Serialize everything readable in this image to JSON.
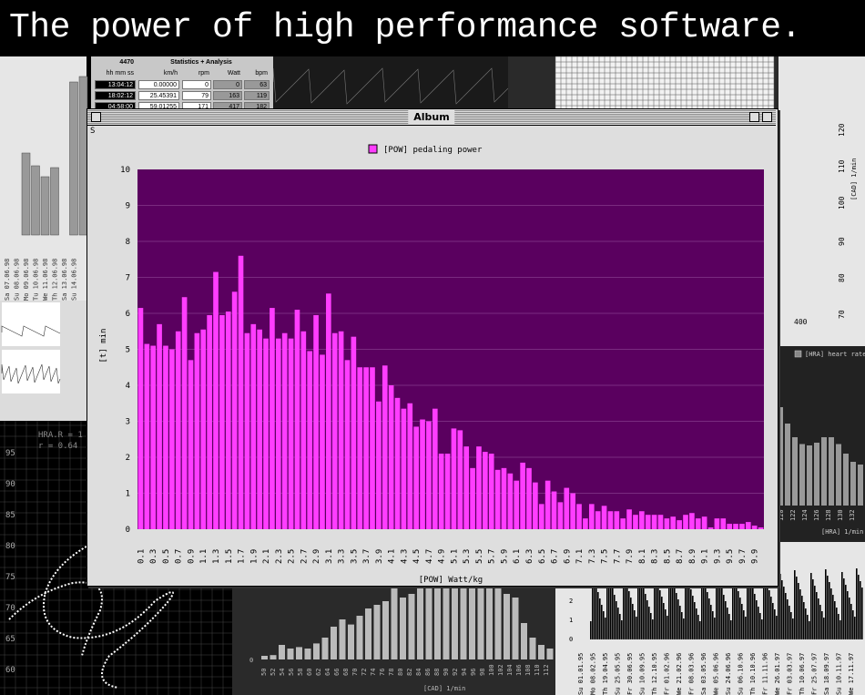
{
  "banner": {
    "text": "The power of high performance software."
  },
  "background": {
    "stats": {
      "title": "Statistics + Analysis",
      "id": "4470",
      "headers": [
        "hh mm ss",
        "km/h",
        "rpm",
        "Watt",
        "bpm"
      ],
      "rows": [
        [
          "13:04:12",
          "0.00000",
          "0",
          "0",
          "63"
        ],
        [
          "18:02:12",
          "25.45391",
          "79",
          "163",
          "119"
        ],
        [
          "04:58:00",
          "59.01255",
          "171",
          "417",
          "182"
        ]
      ]
    },
    "dates_left": [
      "Sa 07.06.98",
      "Su 08.06.98",
      "Mo 09.06.98",
      "Tu 10.06.98",
      "We 11.06.98",
      "Th 12.06.98",
      "Sa 13.06.98",
      "Su 14.06.98"
    ],
    "dates_right": [
      "Su 01.01.95",
      "Mo 08.02.95",
      "Th 19.04.95",
      "Su 25.05.95",
      "Fr 30.06.95",
      "Su 10.09.95",
      "Th 12.10.95",
      "Fr 01.02.96",
      "We 21.02.96",
      "Fr 08.03.96",
      "Sa 03.05.96",
      "We 05.06.96",
      "Su 24.06.96",
      "Su 06.10.96",
      "Th 10.10.96",
      "Fr 11.11.96",
      "We 26.01.97",
      "Fr 03.03.97",
      "Th 10.06.97",
      "Fr 25.07.97",
      "Sa 18.09.97",
      "Su 10.11.97",
      "We 17.11.97"
    ],
    "scatter_yticks": [
      "95",
      "90",
      "85",
      "80",
      "75",
      "70",
      "65",
      "60"
    ],
    "scatter_stats": [
      "HRA.R = 1",
      "r = 0.64"
    ],
    "cad_xticks": [
      "50",
      "52",
      "54",
      "56",
      "58",
      "60",
      "62",
      "64",
      "66",
      "68",
      "70",
      "72",
      "74",
      "76",
      "78",
      "80",
      "82",
      "84",
      "86",
      "88",
      "90",
      "92",
      "94",
      "96",
      "98",
      "100",
      "102",
      "104",
      "106",
      "108",
      "110",
      "112"
    ],
    "cad_label": "[CAD] 1/min",
    "cad_ytick": "0",
    "hra_label": "[HRA] heart rate",
    "hra_xticks": [
      "120",
      "122",
      "124",
      "126",
      "128",
      "130",
      "132"
    ],
    "hra_xlabel": "[HRA] 1/min",
    "grid_label": "[CAD] 1/min",
    "grid_xtick": "400",
    "grid_yticks": [
      "120",
      "110",
      "100",
      "90",
      "80",
      "70",
      "60"
    ],
    "bottom_right_yticks": [
      "2",
      "1",
      "0"
    ]
  },
  "window": {
    "title": "Album",
    "corner": "S"
  },
  "colors": {
    "bar": "#ff3dff",
    "plot_bg": "#5a005f",
    "window_bg": "#dedede"
  },
  "chart_data": {
    "type": "bar",
    "legend": "[POW] pedaling power",
    "xlabel": "[POW] Watt/kg",
    "ylabel": "[t] min",
    "ylim": [
      0,
      10
    ],
    "yticks": [
      "0",
      "1",
      "2",
      "3",
      "4",
      "5",
      "6",
      "7",
      "8",
      "9",
      "10"
    ],
    "xticks": [
      "0.1",
      "0.3",
      "0.5",
      "0.7",
      "0.9",
      "1.1",
      "1.3",
      "1.5",
      "1.7",
      "1.9",
      "2.1",
      "2.3",
      "2.5",
      "2.7",
      "2.9",
      "3.1",
      "3.3",
      "3.5",
      "3.7",
      "3.9",
      "4.1",
      "4.3",
      "4.5",
      "4.7",
      "4.9",
      "5.1",
      "5.3",
      "5.5",
      "5.7",
      "5.9",
      "6.1",
      "6.3",
      "6.5",
      "6.7",
      "6.9",
      "7.1",
      "7.3",
      "7.5",
      "7.7",
      "7.9",
      "8.1",
      "8.3",
      "8.5",
      "8.7",
      "8.9",
      "9.1",
      "9.3",
      "9.5",
      "9.7",
      "9.9"
    ],
    "values": [
      6.15,
      5.15,
      5.1,
      5.7,
      5.1,
      5.0,
      5.5,
      6.45,
      4.7,
      5.45,
      5.55,
      5.95,
      7.15,
      5.95,
      6.05,
      6.6,
      7.6,
      5.45,
      5.7,
      5.55,
      5.3,
      6.15,
      5.3,
      5.45,
      5.3,
      6.1,
      5.5,
      4.95,
      5.95,
      4.85,
      6.55,
      5.45,
      5.5,
      4.7,
      5.35,
      4.5,
      4.5,
      4.5,
      3.55,
      4.55,
      4.0,
      3.65,
      3.35,
      3.5,
      2.85,
      3.05,
      3.0,
      3.35,
      2.1,
      2.1,
      2.8,
      2.75,
      2.3,
      1.7,
      2.3,
      2.15,
      2.1,
      1.65,
      1.7,
      1.55,
      1.35,
      1.85,
      1.7,
      1.3,
      0.7,
      1.35,
      1.05,
      0.75,
      1.15,
      1.0,
      0.7,
      0.3,
      0.7,
      0.5,
      0.65,
      0.5,
      0.5,
      0.3,
      0.55,
      0.4,
      0.5,
      0.4,
      0.4,
      0.4,
      0.3,
      0.35,
      0.25,
      0.4,
      0.45,
      0.3,
      0.35,
      0.05,
      0.3,
      0.3,
      0.15,
      0.15,
      0.15,
      0.2,
      0.1,
      0.05
    ]
  }
}
